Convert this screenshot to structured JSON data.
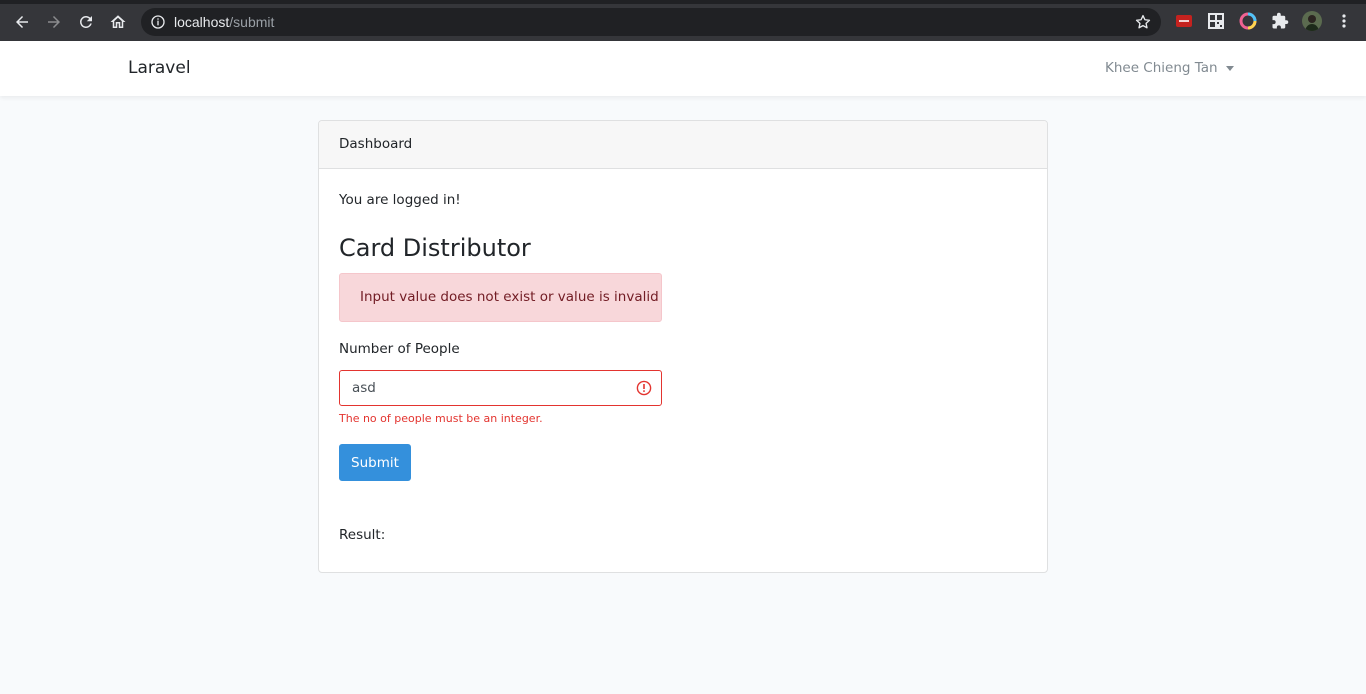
{
  "browser": {
    "url_host": "localhost",
    "url_path": "/submit",
    "extensions": [
      {
        "name": "cors-extension-icon",
        "color": "#c5221f"
      },
      {
        "name": "qr-code-extension-icon",
        "color": "#e8eaed"
      },
      {
        "name": "color-ring-extension-icon",
        "color": "#8ab4f8"
      },
      {
        "name": "puzzle-extensions-icon",
        "color": "#e8eaed"
      }
    ]
  },
  "navbar": {
    "brand": "Laravel",
    "user_name": "Khee Chieng Tan"
  },
  "card": {
    "header": "Dashboard",
    "logged_in_message": "You are logged in!",
    "title": "Card Distributor",
    "alert": "Input value does not exist or value is invalid",
    "form": {
      "label": "Number of People",
      "value": "asd",
      "error": "The no of people must be an integer.",
      "submit_label": "Submit"
    },
    "result_label": "Result:"
  },
  "colors": {
    "primary": "#3490dc",
    "danger": "#e3342f",
    "alert_bg": "#f8d7da",
    "alert_text": "#721c24"
  }
}
